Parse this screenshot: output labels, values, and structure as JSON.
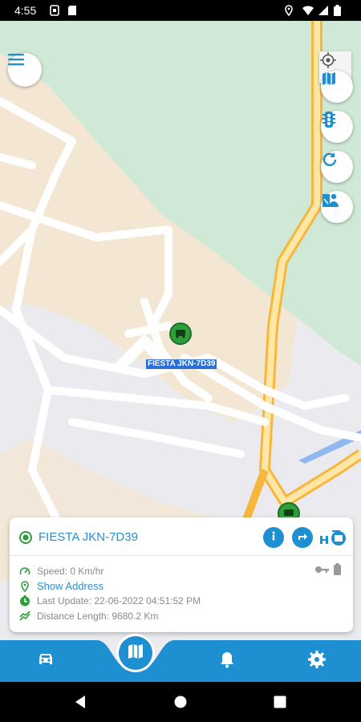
{
  "status_bar": {
    "time": "4:55",
    "icons": [
      "sim-icon",
      "sd-card-icon",
      "location-icon",
      "wifi-icon",
      "signal-icon",
      "battery-icon"
    ]
  },
  "map": {
    "controls": {
      "menu": "menu-icon",
      "my_location": "crosshair-icon",
      "side_buttons": [
        "map-layers-icon",
        "traffic-light-icon",
        "refresh-icon",
        "vehicle-list-icon"
      ]
    },
    "marker_label": "FIESTA JKN-7D39"
  },
  "vehicle_card": {
    "name": "FIESTA JKN-7D39",
    "status_color": "#2e9e3a",
    "speed": "Speed: 0 Km/hr",
    "address_link": "Show Address",
    "last_update": "Last Update: 22-06-2022 04:51:52 PM",
    "distance": "Distance Length: 9680.2 Km",
    "actions": [
      "info-icon",
      "directions-icon",
      "history-icon"
    ]
  },
  "bottom_nav": {
    "items": [
      "car-icon",
      "map-icon",
      "bell-icon",
      "gear-icon"
    ],
    "active": "map-icon"
  },
  "colors": {
    "accent": "#1e8fd0",
    "park_green": "#cfe9d6",
    "road_orange": "#f6b73c"
  }
}
